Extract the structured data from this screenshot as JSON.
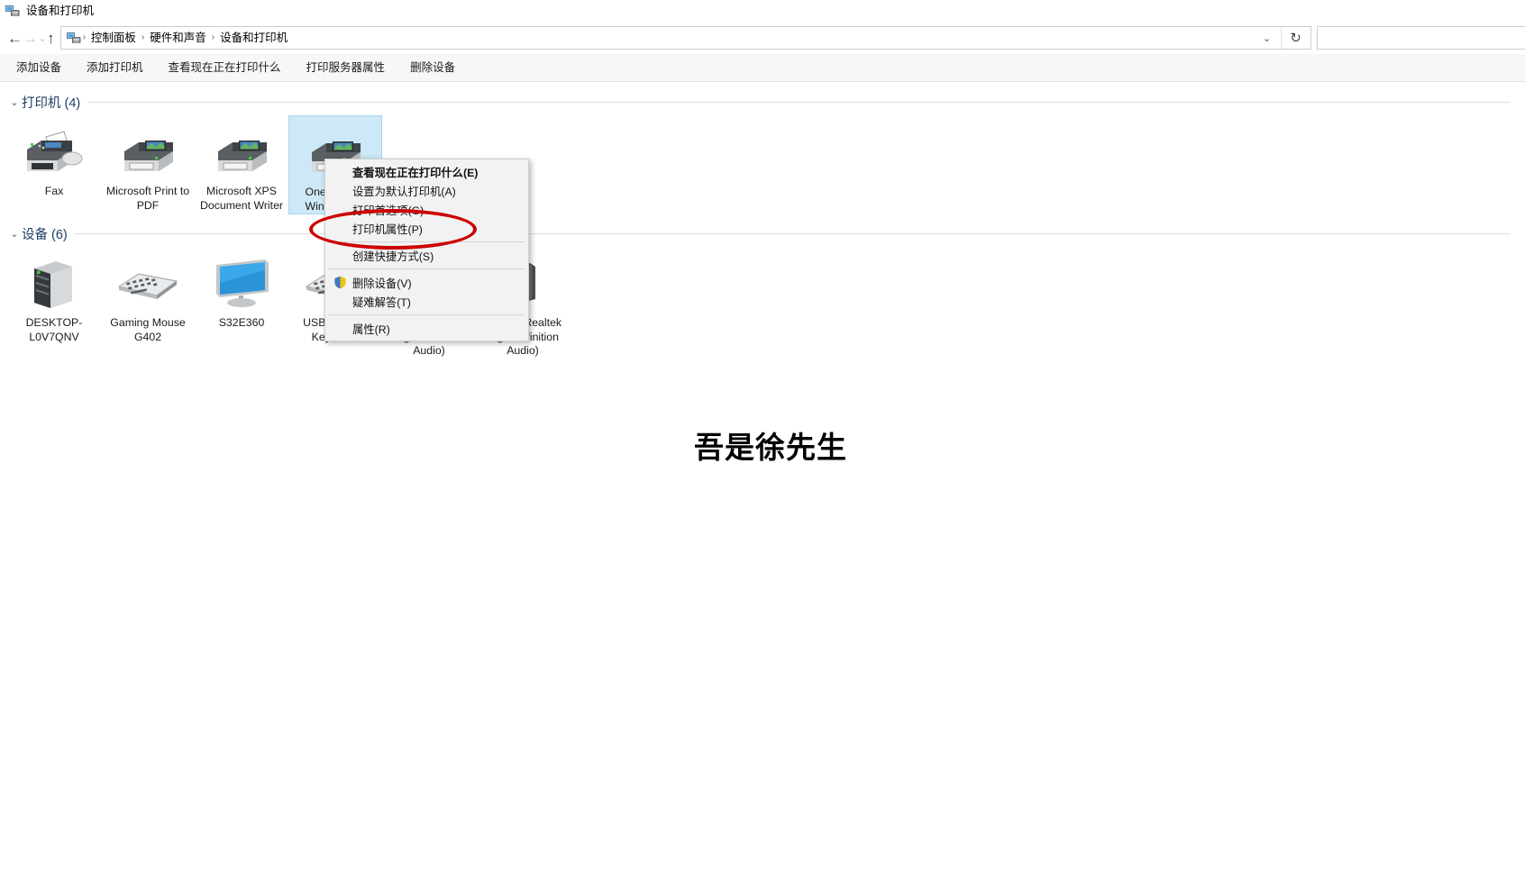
{
  "window": {
    "title": "设备和打印机",
    "title_icon": "devices-printers-icon"
  },
  "navbar": {
    "back_icon": "back-arrow-icon",
    "forward_icon": "forward-arrow-icon",
    "recent_icon": "chevron-down-icon",
    "up_icon": "up-arrow-icon",
    "address_icon": "devices-printers-icon",
    "breadcrumbs": [
      "控制面板",
      "硬件和声音",
      "设备和打印机"
    ],
    "separator": "›",
    "dropdown_icon": "chevron-down-icon",
    "refresh_icon": "refresh-icon",
    "search_placeholder": ""
  },
  "commandbar": {
    "items": [
      {
        "label": "添加设备",
        "name": "add-device"
      },
      {
        "label": "添加打印机",
        "name": "add-printer"
      },
      {
        "label": "查看现在正在打印什么",
        "name": "see-whats-printing"
      },
      {
        "label": "打印服务器属性",
        "name": "print-server-properties"
      },
      {
        "label": "删除设备",
        "name": "remove-device"
      }
    ]
  },
  "groups": [
    {
      "title": "打印机 (4)",
      "chevron": "⌄",
      "items": [
        {
          "label": "Fax",
          "icon": "fax-machine-icon",
          "selected": false
        },
        {
          "label": "Microsoft Print to PDF",
          "icon": "printer-icon",
          "selected": false
        },
        {
          "label": "Microsoft XPS Document Writer",
          "icon": "printer-icon",
          "selected": false
        },
        {
          "label": "OneNote for Windows 10",
          "icon": "printer-icon",
          "selected": true
        }
      ]
    },
    {
      "title": "设备 (6)",
      "chevron": "⌄",
      "items": [
        {
          "label": "DESKTOP-L0V7QNV",
          "icon": "desktop-tower-icon",
          "selected": false
        },
        {
          "label": "Gaming Mouse G402",
          "icon": "keyboard-icon",
          "selected": false
        },
        {
          "label": "S32E360",
          "icon": "monitor-icon",
          "selected": false
        },
        {
          "label": "USB Gaming Keyboard",
          "icon": "keyboard-icon",
          "selected": false
        },
        {
          "label": "麦克风 (Realtek High Definition Audio)",
          "icon": "microphone-icon",
          "selected": false
        },
        {
          "label": "扬声器 (Realtek High Definition Audio)",
          "icon": "speaker-icon",
          "selected": false
        }
      ]
    }
  ],
  "context_menu": {
    "items": [
      {
        "label": "查看现在正在打印什么(E)",
        "bold": true,
        "shield": false,
        "name": "see-whats-printing"
      },
      {
        "label": "设置为默认打印机(A)",
        "bold": false,
        "shield": false,
        "name": "set-as-default-printer"
      },
      {
        "label": "打印首选项(G)",
        "bold": false,
        "shield": false,
        "name": "printing-preferences"
      },
      {
        "label": "打印机属性(P)",
        "bold": false,
        "shield": false,
        "name": "printer-properties"
      },
      {
        "separator": true
      },
      {
        "label": "创建快捷方式(S)",
        "bold": false,
        "shield": false,
        "name": "create-shortcut"
      },
      {
        "separator": true
      },
      {
        "label": "删除设备(V)",
        "bold": false,
        "shield": true,
        "name": "remove-device"
      },
      {
        "label": "疑难解答(T)",
        "bold": false,
        "shield": false,
        "name": "troubleshoot"
      },
      {
        "separator": true
      },
      {
        "label": "属性(R)",
        "bold": false,
        "shield": false,
        "name": "properties"
      }
    ]
  },
  "annotation": {
    "shape": "ellipse",
    "color": "#cc0000",
    "targets": "打印机属性(P)"
  },
  "watermark": {
    "text": "吾是徐先生"
  },
  "colors": {
    "selection": "#cde8f7",
    "group_title": "#1f3d66",
    "commandbar_bg": "#f7f7f7",
    "menu_bg": "#f2f2f2",
    "annotation": "#cc0000"
  }
}
